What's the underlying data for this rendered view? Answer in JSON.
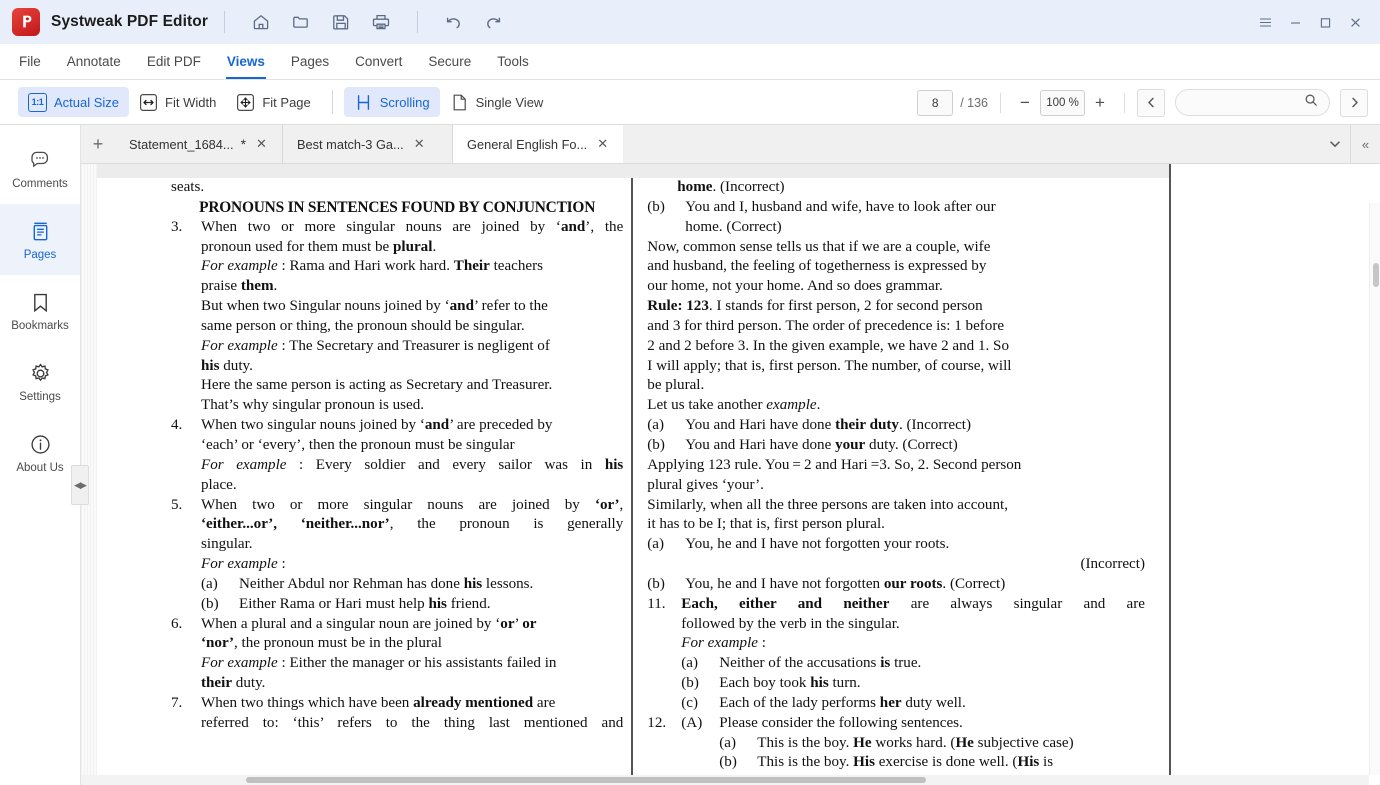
{
  "app": {
    "title": "Systweak PDF Editor",
    "logo_icon": "pdf-app-logo",
    "quick_actions": [
      {
        "name": "home-icon",
        "label": "Home"
      },
      {
        "name": "open-folder-icon",
        "label": "Open"
      },
      {
        "name": "save-icon",
        "label": "Save"
      },
      {
        "name": "print-icon",
        "label": "Print"
      },
      {
        "name": "undo-icon",
        "label": "Undo"
      },
      {
        "name": "redo-icon",
        "label": "Redo"
      }
    ],
    "window_controls": [
      {
        "name": "hamburger-menu-icon",
        "glyph": "☰"
      },
      {
        "name": "minimize-icon",
        "glyph": "─"
      },
      {
        "name": "maximize-icon",
        "glyph": "□"
      },
      {
        "name": "close-icon",
        "glyph": "✕"
      }
    ]
  },
  "menubar": {
    "items": [
      {
        "label": "File",
        "active": false
      },
      {
        "label": "Annotate",
        "active": false
      },
      {
        "label": "Edit PDF",
        "active": false
      },
      {
        "label": "Views",
        "active": true
      },
      {
        "label": "Pages",
        "active": false
      },
      {
        "label": "Convert",
        "active": false
      },
      {
        "label": "Secure",
        "active": false
      },
      {
        "label": "Tools",
        "active": false
      }
    ]
  },
  "toolbar": {
    "actual_size": {
      "label": "Actual Size",
      "icon": "one-to-one-icon",
      "active": true
    },
    "fit_width": {
      "label": "Fit Width",
      "icon": "fit-width-icon",
      "active": false
    },
    "fit_page": {
      "label": "Fit Page",
      "icon": "fit-page-icon",
      "active": false
    },
    "scrolling": {
      "label": "Scrolling",
      "icon": "scrolling-icon",
      "active": true
    },
    "single_view": {
      "label": "Single View",
      "icon": "single-page-icon",
      "active": false
    }
  },
  "pagenav": {
    "current_page": "8",
    "total_pages": "/ 136",
    "zoom_out": "−",
    "zoom_level": "100 %",
    "zoom_in": "+",
    "prev_label": "‹",
    "next_label": "›",
    "search_placeholder": "",
    "search_value": "",
    "search_icon": "search-icon"
  },
  "sidebar": {
    "items": [
      {
        "label": "Comments",
        "icon": "comments-icon",
        "active": false
      },
      {
        "label": "Pages",
        "icon": "pages-icon",
        "active": true
      },
      {
        "label": "Bookmarks",
        "icon": "bookmark-icon",
        "active": false
      },
      {
        "label": "Settings",
        "icon": "gear-icon",
        "active": false
      },
      {
        "label": "About Us",
        "icon": "info-icon",
        "active": false
      }
    ],
    "splitter": "◀▶"
  },
  "tabs": {
    "add_label": "+",
    "overflow_icon": "chevron-down-icon",
    "collapse_icon": "collapse-panel-icon",
    "collapse_label": "«",
    "close_label": "✕",
    "items": [
      {
        "title": "Statement_1684...",
        "dirty": "*",
        "active": false
      },
      {
        "title": "Best match-3 Ga...",
        "dirty": "",
        "active": false
      },
      {
        "title": "General English Fo...",
        "dirty": "",
        "active": true
      }
    ]
  },
  "document": {
    "left_column": {
      "top_fragment": "seats.",
      "heading": "PRONOUNS IN SENTENCES FOUND BY CONJUNCTION",
      "items": [
        {
          "num": "3.",
          "lines": [
            "When two or more singular nouns are joined by ‘and’, the pronoun used for them must be plural.",
            "For example : Rama and Hari work hard. Their teachers praise them.",
            "But when two Singular nouns joined by ‘and’ refer to the same person or thing, the pronoun should be singular.",
            "For example : The Secretary and Treasurer is negligent of his duty.",
            "Here the same person is acting as Secretary and Treasurer. That’s why singular pronoun is used."
          ]
        },
        {
          "num": "4.",
          "lines": [
            "When two singular nouns joined by ‘and’ are preceded by ‘each’ or ‘every’, then the pronoun must be singular",
            "For example : Every soldier and every sailor was in his place."
          ]
        },
        {
          "num": "5.",
          "lines": [
            "When two or more singular nouns are joined by ‘or’, ‘either...or’, ‘neither...nor’, the pronoun is generally singular.",
            "For example :",
            "(a) Neither Abdul nor Rehman has done his lessons.",
            "(b) Either Rama or Hari must help his friend."
          ]
        },
        {
          "num": "6.",
          "lines": [
            "When a plural and a singular noun are joined by ‘or’ or ‘nor’, the pronoun must be in the plural",
            "For example : Either the manager or his assistants failed in their duty."
          ]
        },
        {
          "num": "7.",
          "lines": [
            "When two things which have been already mentioned are referred to: ‘this’ refers to the thing last mentioned and"
          ]
        }
      ]
    },
    "right_column": {
      "top_lines": [
        "home. (Incorrect)",
        "(b) You and I, husband and wife, have to look after our home. (Correct)",
        "Now, common sense tells us that if we are a couple, wife and husband, the feeling of togetherness is expressed by our home, not your home. And so does grammar.",
        "Rule: 123. I stands for first person, 2 for second person and 3 for third person. The order of precedence is: 1 before 2 and 2 before 3. In the given example, we have 2 and 1. So I will apply; that is, first person. The number, of course, will be plural.",
        "Let us take another example.",
        "(a) You and Hari have done their duty. (Incorrect)",
        "(b) You and Hari have done your duty. (Correct)",
        "Applying 123 rule. You = 2 and Hari =3. So, 2. Second person plural gives ‘your’.",
        "Similarly, when all the three persons are taken into account, it has to be I; that is, first person plural.",
        "(a) You, he and I have not forgotten your roots.",
        "(Incorrect)",
        "(b) You, he and I have not forgotten our roots. (Correct)"
      ],
      "items": [
        {
          "num": "11.",
          "lines": [
            "Each, either and neither are always singular and are followed by the verb in the singular.",
            "For example :",
            "(a) Neither of the accusations is true.",
            "(b) Each boy took his turn.",
            "(c) Each of the lady performs her duty well."
          ]
        },
        {
          "num": "12.",
          "lines": [
            "(A) Please consider the following sentences.",
            "(a) This is the boy. He works hard. (He subjective case)",
            "(b) This is the boy. His exercise is done well. (His is"
          ]
        }
      ]
    }
  },
  "colors": {
    "accent": "#1667d4",
    "titlebar_bg": "#e9effa",
    "logo_red": "#c2161c",
    "active_tool_bg": "#e2e8fb"
  }
}
